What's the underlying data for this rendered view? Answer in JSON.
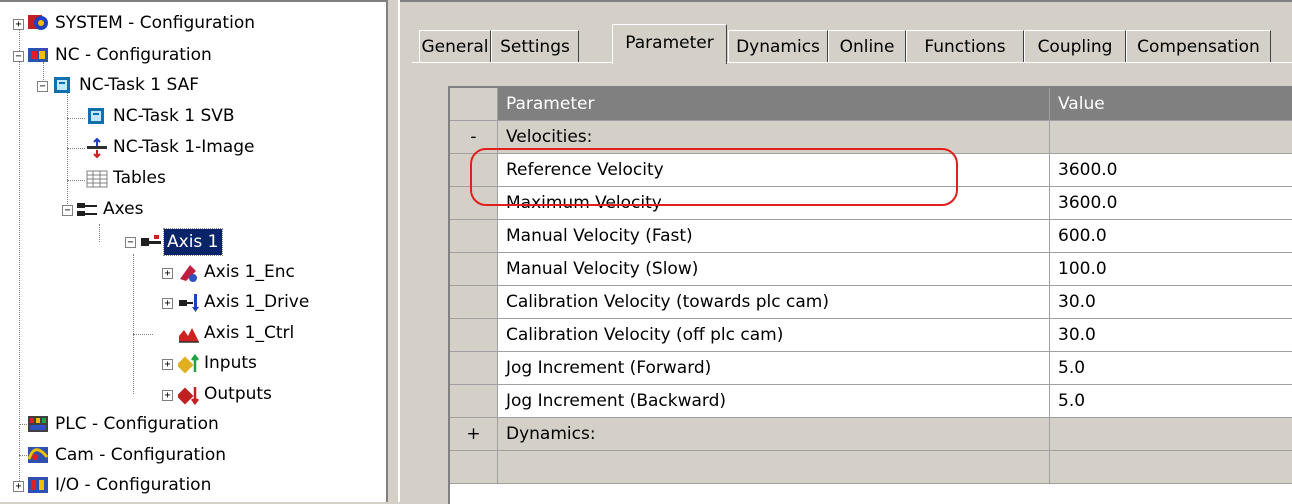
{
  "tree": {
    "items": [
      {
        "label": "SYSTEM - Configuration",
        "expander": "+"
      },
      {
        "label": "NC - Configuration",
        "expander": "−"
      },
      {
        "label": "NC-Task 1 SAF",
        "expander": "−"
      },
      {
        "label": "NC-Task 1 SVB",
        "expander": ""
      },
      {
        "label": "NC-Task 1-Image",
        "expander": ""
      },
      {
        "label": "Tables",
        "expander": ""
      },
      {
        "label": "Axes",
        "expander": "−"
      },
      {
        "label": "Axis 1",
        "expander": "−",
        "selected": true
      },
      {
        "label": "Axis 1_Enc",
        "expander": "+"
      },
      {
        "label": "Axis 1_Drive",
        "expander": "+"
      },
      {
        "label": "Axis 1_Ctrl",
        "expander": ""
      },
      {
        "label": "Inputs",
        "expander": "+"
      },
      {
        "label": "Outputs",
        "expander": "+"
      },
      {
        "label": "PLC - Configuration",
        "expander": ""
      },
      {
        "label": "Cam - Configuration",
        "expander": ""
      },
      {
        "label": "I/O - Configuration",
        "expander": "+"
      }
    ]
  },
  "tabs": [
    "General",
    "Settings",
    "Parameter",
    "Dynamics",
    "Online",
    "Functions",
    "Coupling",
    "Compensation"
  ],
  "active_tab": "Parameter",
  "grid": {
    "headers": {
      "parameter": "Parameter",
      "value": "Value"
    },
    "rows": [
      {
        "kind": "group",
        "gutter": "-",
        "name": "Velocities:",
        "value": ""
      },
      {
        "kind": "param",
        "gutter": "",
        "name": "Reference Velocity",
        "value": "3600.0"
      },
      {
        "kind": "param",
        "gutter": "",
        "name": "Maximum Velocity",
        "value": "3600.0"
      },
      {
        "kind": "param",
        "gutter": "",
        "name": "Manual Velocity (Fast)",
        "value": "600.0"
      },
      {
        "kind": "param",
        "gutter": "",
        "name": "Manual Velocity (Slow)",
        "value": "100.0"
      },
      {
        "kind": "param",
        "gutter": "",
        "name": "Calibration Velocity (towards plc cam)",
        "value": "30.0"
      },
      {
        "kind": "param",
        "gutter": "",
        "name": "Calibration Velocity (off plc cam)",
        "value": "30.0"
      },
      {
        "kind": "param",
        "gutter": "",
        "name": "Jog Increment (Forward)",
        "value": "5.0"
      },
      {
        "kind": "param",
        "gutter": "",
        "name": "Jog Increment (Backward)",
        "value": "5.0"
      },
      {
        "kind": "group",
        "gutter": "+",
        "name": "Dynamics:",
        "value": ""
      },
      {
        "kind": "group",
        "gutter": "",
        "name": "",
        "value": ""
      }
    ]
  },
  "annotation": {
    "color": "#e0201c"
  }
}
